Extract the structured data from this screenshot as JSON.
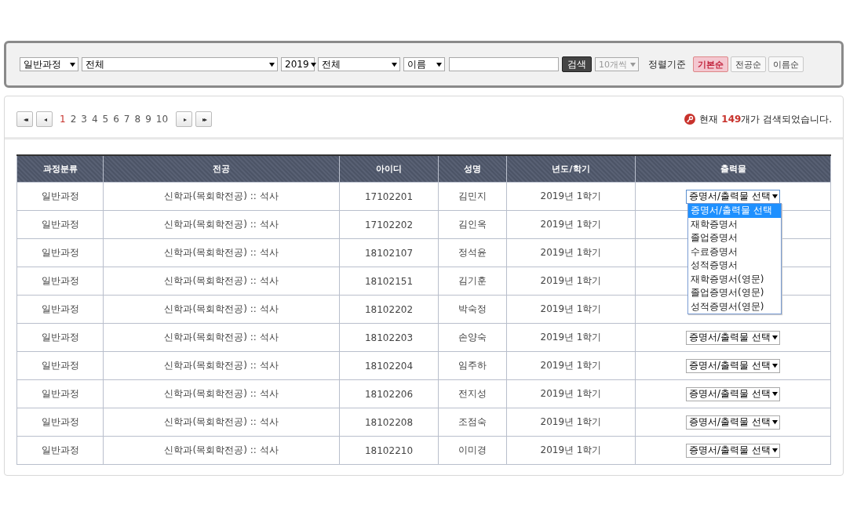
{
  "search_panel": {
    "filters": [
      {
        "value": "일반과정"
      },
      {
        "value": "전체"
      },
      {
        "value": "2019"
      },
      {
        "value": "전체"
      },
      {
        "value": "이름"
      }
    ],
    "search_button": "검색",
    "per_page": {
      "value": "10개씩",
      "disabled": true
    },
    "sort_label": "정렬기준",
    "sort_buttons": [
      {
        "label": "기본순",
        "selected": true
      },
      {
        "label": "전공순",
        "selected": false
      },
      {
        "label": "이름순",
        "selected": false
      }
    ]
  },
  "pagination": {
    "first": "◂◂",
    "prev": "◂",
    "pages": [
      {
        "label": "1",
        "selected": true
      },
      {
        "label": "2",
        "selected": false
      },
      {
        "label": "3",
        "selected": false
      },
      {
        "label": "4",
        "selected": false
      },
      {
        "label": "5",
        "selected": false
      },
      {
        "label": "6",
        "selected": false
      },
      {
        "label": "7",
        "selected": false
      },
      {
        "label": "8",
        "selected": false
      },
      {
        "label": "9",
        "selected": false
      },
      {
        "label": "10",
        "selected": false
      }
    ],
    "next": "▸",
    "last": "▸▸"
  },
  "result_count": "현재 **149**개가 검색되었습니다.",
  "table": {
    "columns": [
      "과정분류",
      "전공",
      "아이디",
      "성명",
      "년도/학기",
      "출력물"
    ],
    "rows": [
      {
        "cells": [
          "일반과정",
          "신학과(목회학전공) :: 석사",
          "17102201",
          "김민지",
          "2019년 1학기"
        ],
        "output_select": "증명서/출력물 선택",
        "open": true
      },
      {
        "cells": [
          "일반과정",
          "신학과(목회학전공) :: 석사",
          "17102202",
          "김인옥",
          "2019년 1학기"
        ]
      },
      {
        "cells": [
          "일반과정",
          "신학과(목회학전공) :: 석사",
          "18102107",
          "정석윤",
          "2019년 1학기"
        ]
      },
      {
        "cells": [
          "일반과정",
          "신학과(목회학전공) :: 석사",
          "18102151",
          "김기훈",
          "2019년 1학기"
        ]
      },
      {
        "cells": [
          "일반과정",
          "신학과(목회학전공) :: 석사",
          "18102202",
          "박숙정",
          "2019년 1학기"
        ]
      },
      {
        "cells": [
          "일반과정",
          "신학과(목회학전공) :: 석사",
          "18102203",
          "손양숙",
          "2019년 1학기"
        ],
        "output_select": "증명서/출력물 선택",
        "open": false
      },
      {
        "cells": [
          "일반과정",
          "신학과(목회학전공) :: 석사",
          "18102204",
          "임주하",
          "2019년 1학기"
        ],
        "output_select": "증명서/출력물 선택",
        "open": false
      },
      {
        "cells": [
          "일반과정",
          "신학과(목회학전공) :: 석사",
          "18102206",
          "전지성",
          "2019년 1학기"
        ],
        "output_select": "증명서/출력물 선택",
        "open": false
      },
      {
        "cells": [
          "일반과정",
          "신학과(목회학전공) :: 석사",
          "18102208",
          "조점숙",
          "2019년 1학기"
        ],
        "output_select": "증명서/출력물 선택",
        "open": false
      },
      {
        "cells": [
          "일반과정",
          "신학과(목회학전공) :: 석사",
          "18102210",
          "이미경",
          "2019년 1학기"
        ],
        "output_select": "증명서/출력물 선택",
        "open": false
      }
    ]
  },
  "output_options": [
    {
      "label": "증명서/출력물 선택",
      "selected": true
    },
    {
      "label": "재학증명서",
      "selected": false
    },
    {
      "label": "졸업증명서",
      "selected": false
    },
    {
      "label": "수료증명서",
      "selected": false
    },
    {
      "label": "성적증명서",
      "selected": false
    },
    {
      "label": "재학증명서(영문)",
      "selected": false
    },
    {
      "label": "졸업증명서(영문)",
      "selected": false
    },
    {
      "label": "성적증명서(영문)",
      "selected": false
    }
  ]
}
